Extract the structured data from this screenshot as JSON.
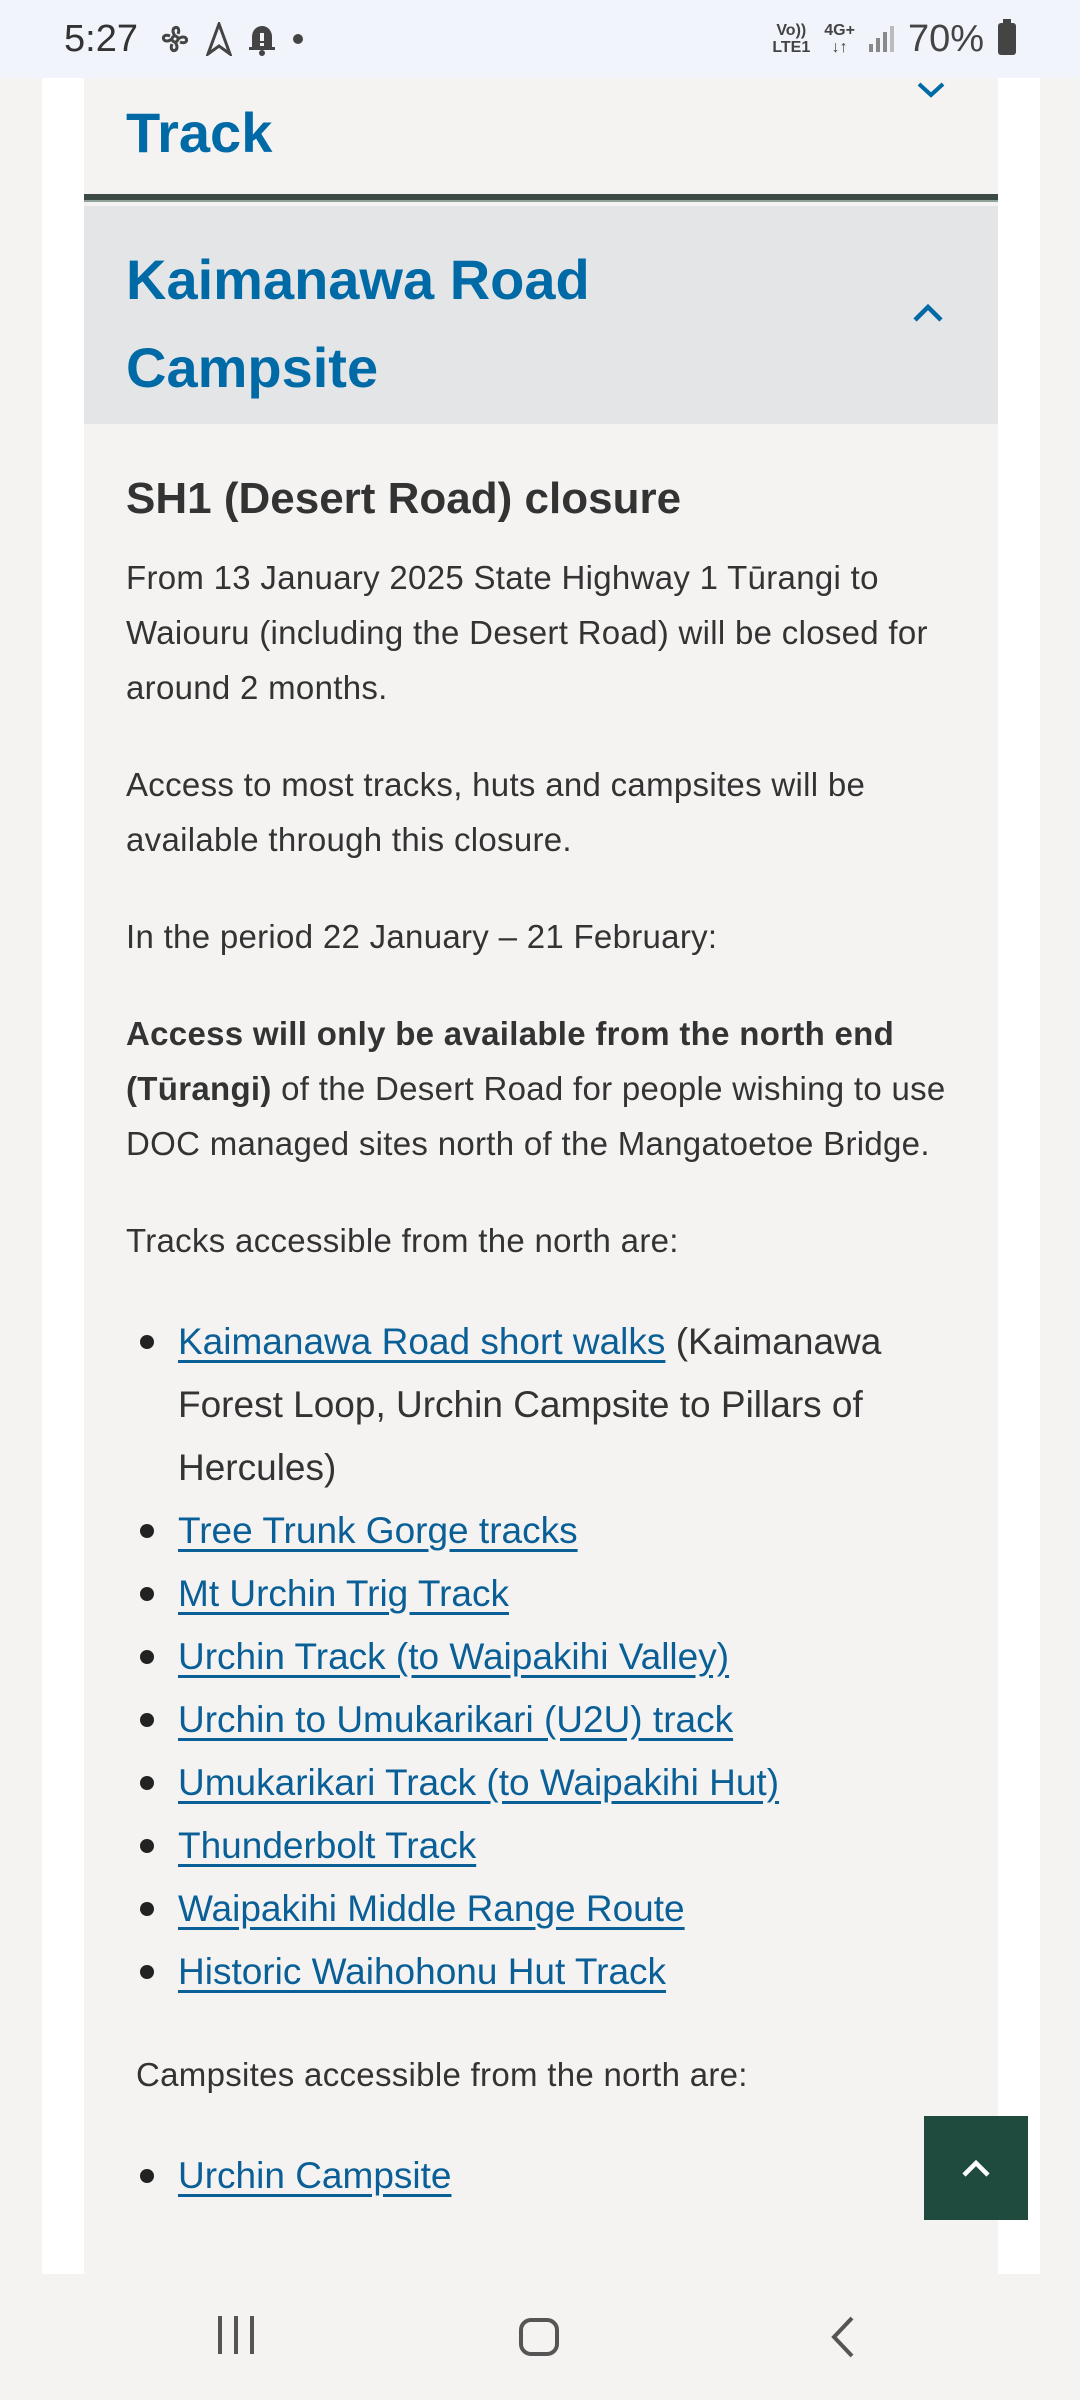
{
  "status_bar": {
    "time": "5:27",
    "network_top": "Vo))",
    "network_bottom": "LTE1",
    "data_top": "4G+",
    "data_bottom": "↓↑",
    "battery": "70%"
  },
  "accordion_prev": {
    "title": "Track"
  },
  "accordion": {
    "title": "Kaimanawa Road Campsite"
  },
  "content": {
    "heading": "SH1 (Desert Road) closure",
    "p1": "From 13 January 2025 State Highway 1 Tūrangi to Waiouru (including the Desert Road) will be closed for around 2 months.",
    "p2": "Access to most tracks, huts and campsites will be available through this closure.",
    "p3": "In the period 22 January – 21 February:",
    "p4_bold": "Access will only be available from the north end (Tūrangi)",
    "p4_rest": " of the Desert Road for people wishing to use DOC managed sites north of the Mangatoetoe Bridge.",
    "p5": "Tracks accessible from the north are:",
    "tracks": [
      {
        "link": "Kaimanawa Road short walks",
        "note": "(Kaimanawa Forest Loop, Urchin Campsite to Pillars of Hercules)"
      },
      {
        "link": "Tree Trunk Gorge tracks"
      },
      {
        "link": "Mt Urchin Trig Track"
      },
      {
        "link": "Urchin Track (to Waipakihi Valley)"
      },
      {
        "link": "Urchin to Umukarikari (U2U) track"
      },
      {
        "link": "Umukarikari Track (to Waipakihi Hut)"
      },
      {
        "link": "Thunderbolt Track"
      },
      {
        "link": "Waipakihi Middle Range Route"
      },
      {
        "link": "Historic Waihohonu Hut Track"
      }
    ],
    "p6": "Campsites accessible from the north are:",
    "campsites": [
      {
        "link": "Urchin Campsite"
      }
    ]
  },
  "icons": {
    "chevron_up": "chevron-up-icon",
    "chevron_down": "chevron-down-icon",
    "back_to_top": "arrow-up-icon"
  },
  "colors": {
    "link": "#0a5f97",
    "heading_blue": "#006aa7",
    "dark_green": "#1f4a3e",
    "header_bg": "#e4e5e7"
  }
}
